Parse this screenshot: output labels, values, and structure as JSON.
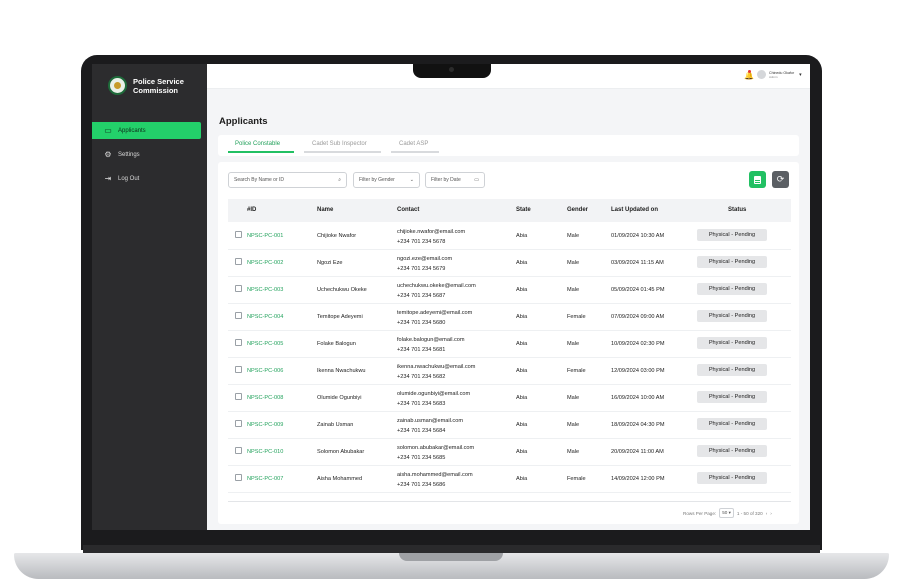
{
  "brand": {
    "name": "Police Service Commission"
  },
  "sidebar": {
    "items": [
      {
        "label": "Applicants",
        "icon": "folder-icon",
        "active": true
      },
      {
        "label": "Settings",
        "icon": "gear-icon"
      },
      {
        "label": "Log Out",
        "icon": "logout-icon"
      }
    ]
  },
  "topbar": {
    "user_name": "Chinedu Okafor",
    "user_role": "Admin"
  },
  "page": {
    "title": "Applicants"
  },
  "tabs": [
    {
      "label": "Police Constable",
      "active": true
    },
    {
      "label": "Cadet Sub Inspector"
    },
    {
      "label": "Cadet ASP"
    }
  ],
  "filters": {
    "search_placeholder": "Search By Name or ID",
    "gender_label": "Filter by Gender",
    "date_label": "Filter by Date"
  },
  "table": {
    "columns": [
      "#ID",
      "Name",
      "Contact",
      "State",
      "Gender",
      "Last Updated on",
      "Status"
    ],
    "rows": [
      {
        "id": "NPSC-PC-001",
        "name": "Chijioke Nwafor",
        "email": "chijioke.nwafor@email.com",
        "phone": "+234 701 234 5678",
        "state": "Abia",
        "gender": "Male",
        "updated": "01/09/2024 10:30 AM",
        "status": "Physical - Pending"
      },
      {
        "id": "NPSC-PC-002",
        "name": "Ngozi Eze",
        "email": "ngozi.eze@email.com",
        "phone": "+234 701 234 5679",
        "state": "Abia",
        "gender": "Male",
        "updated": "03/09/2024 11:15 AM",
        "status": "Physical - Pending"
      },
      {
        "id": "NPSC-PC-003",
        "name": "Uchechukwu Okeke",
        "email": "uchechukwu.okeke@email.com",
        "phone": "+234 701 234 5687",
        "state": "Abia",
        "gender": "Male",
        "updated": "05/09/2024 01:45 PM",
        "status": "Physical - Pending"
      },
      {
        "id": "NPSC-PC-004",
        "name": "Temitope Adeyemi",
        "email": "temitope.adeyemi@email.com",
        "phone": "+234 701 234 5680",
        "state": "Abia",
        "gender": "Female",
        "updated": "07/09/2024 09:00 AM",
        "status": "Physical - Pending"
      },
      {
        "id": "NPSC-PC-005",
        "name": "Folake Balogun",
        "email": "folake.balogun@email.com",
        "phone": "+234 701 234 5681",
        "state": "Abia",
        "gender": "Male",
        "updated": "10/09/2024 02:30 PM",
        "status": "Physical - Pending"
      },
      {
        "id": "NPSC-PC-006",
        "name": "Ikenna Nwachukwu",
        "email": "ikenna.nwachukwu@email.com",
        "phone": "+234 701 234 5682",
        "state": "Abia",
        "gender": "Female",
        "updated": "12/09/2024 03:00 PM",
        "status": "Physical - Pending"
      },
      {
        "id": "NPSC-PC-008",
        "name": "Olumide Ogunbiyi",
        "email": "olumide.ogunbiyi@email.com",
        "phone": "+234 701 234 5683",
        "state": "Abia",
        "gender": "Male",
        "updated": "16/09/2024 10:00 AM",
        "status": "Physical - Pending"
      },
      {
        "id": "NPSC-PC-009",
        "name": "Zainab Usman",
        "email": "zainab.usman@email.com",
        "phone": "+234 701 234 5684",
        "state": "Abia",
        "gender": "Male",
        "updated": "18/09/2024 04:30 PM",
        "status": "Physical - Pending"
      },
      {
        "id": "NPSC-PC-010",
        "name": "Solomon Abubakar",
        "email": "solomon.abubakar@email.com",
        "phone": "+234 701 234 5685",
        "state": "Abia",
        "gender": "Male",
        "updated": "20/09/2024 11:00 AM",
        "status": "Physical - Pending"
      },
      {
        "id": "NPSC-PC-007",
        "name": "Aisha Mohammed",
        "email": "aisha.mohammed@email.com",
        "phone": "+234 701 234 5686",
        "state": "Abia",
        "gender": "Female",
        "updated": "14/09/2024 12:00 PM",
        "status": "Physical - Pending"
      }
    ]
  },
  "pagination": {
    "rows_per_page_label": "Rows Per Page:",
    "rows_per_page": "50",
    "range": "1 - 50 of 320"
  },
  "colors": {
    "accent": "#22c063",
    "sidebar": "#2c2c2e",
    "id_text": "#22a25c"
  }
}
